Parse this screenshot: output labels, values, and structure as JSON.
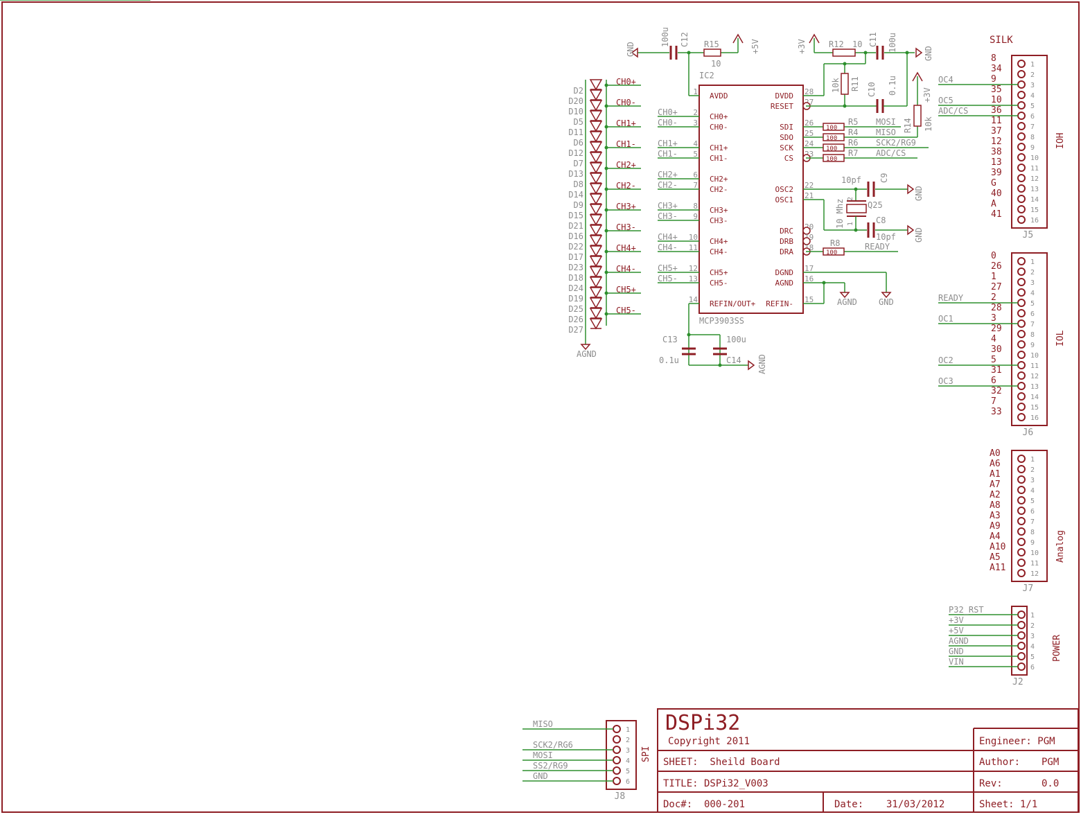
{
  "title_block": {
    "title": "DSPi32",
    "copyright": "Copyright 2011",
    "sheet": "SHEET:  Sheild Board",
    "name": "TITLE: DSPi32_V003",
    "doc": "Doc#:  000-201",
    "date_label": "Date:",
    "date": "31/03/2012",
    "engineer": "Engineer: PGM",
    "author_label": "Author:",
    "author": "PGM",
    "rev_label": "Rev:",
    "rev": "0.0",
    "sheet_no": "Sheet: 1/1"
  },
  "ic": {
    "ref": "IC2",
    "part": "MCP3903SS",
    "left_pins": [
      {
        "num": "1",
        "name": "AVDD",
        "net": ""
      },
      {
        "num": "2",
        "name": "CH0+",
        "net": "CH0+"
      },
      {
        "num": "3",
        "name": "CH0-",
        "net": "CH0-"
      },
      {
        "num": "4",
        "name": "CH1+",
        "net": "CH1+"
      },
      {
        "num": "5",
        "name": "CH1-",
        "net": "CH1-"
      },
      {
        "num": "6",
        "name": "CH2+",
        "net": "CH2+"
      },
      {
        "num": "7",
        "name": "CH2-",
        "net": "CH2-"
      },
      {
        "num": "8",
        "name": "CH3+",
        "net": "CH3+"
      },
      {
        "num": "9",
        "name": "CH3-",
        "net": "CH3-"
      },
      {
        "num": "10",
        "name": "CH4+",
        "net": "CH4+"
      },
      {
        "num": "11",
        "name": "CH4-",
        "net": "CH4-"
      },
      {
        "num": "12",
        "name": "CH5+",
        "net": "CH5+"
      },
      {
        "num": "13",
        "name": "CH5-",
        "net": "CH5-"
      },
      {
        "num": "14",
        "name": "REFIN/OUT+",
        "net": ""
      }
    ],
    "right_pins": [
      {
        "num": "28",
        "name": "DVDD"
      },
      {
        "num": "27",
        "name": "RESET"
      },
      {
        "num": "26",
        "name": "SDI"
      },
      {
        "num": "25",
        "name": "SDO"
      },
      {
        "num": "24",
        "name": "SCK"
      },
      {
        "num": "23",
        "name": "CS"
      },
      {
        "num": "22",
        "name": "OSC2"
      },
      {
        "num": "21",
        "name": "OSC1"
      },
      {
        "num": "20",
        "name": "DRC"
      },
      {
        "num": "19",
        "name": "DRB"
      },
      {
        "num": "18",
        "name": "DRA"
      },
      {
        "num": "17",
        "name": "DGND"
      },
      {
        "num": "16",
        "name": "AGND"
      },
      {
        "num": "15",
        "name": "REFIN-"
      }
    ]
  },
  "diodes": {
    "left_labels": [
      "D2",
      "D20",
      "D10",
      "D5",
      "D11",
      "D6",
      "D12",
      "D7",
      "D13",
      "D8",
      "D14",
      "D9",
      "D15",
      "D21",
      "D16",
      "D22",
      "D17",
      "D23",
      "D18",
      "D24",
      "D19",
      "D25",
      "D26",
      "D27"
    ],
    "nets": [
      "CH0+",
      "CH0-",
      "CH1+",
      "CH1-",
      "CH2+",
      "CH2-",
      "CH3+",
      "CH3-",
      "CH4+",
      "CH4-",
      "CH5+",
      "CH5-"
    ],
    "ground": "AGND"
  },
  "passives": {
    "c12": {
      "ref": "C12",
      "value": "100u"
    },
    "r15": {
      "ref": "R15",
      "value": "10"
    },
    "r12": {
      "ref": "R12",
      "value": "10"
    },
    "c11": {
      "ref": "C11",
      "value": "100u"
    },
    "r11": {
      "ref": "R11",
      "value": "10k"
    },
    "c10": {
      "ref": "C10",
      "value": "0.1u"
    },
    "r14": {
      "ref": "R14",
      "value": "10k"
    },
    "r5": "R5",
    "r4": "R4",
    "r6": "R6",
    "r7": "R7",
    "c9": {
      "ref": "C9",
      "value": "10pf"
    },
    "c8": {
      "ref": "C8",
      "value": "10pf"
    },
    "q25": {
      "ref": "Q25",
      "value": "10 Mhz",
      "pin1": "1",
      "pin2": "2"
    },
    "r8": {
      "ref": "R8"
    },
    "c13": {
      "ref": "C13",
      "value": "0.1u"
    },
    "c14": {
      "ref": "C14",
      "value": "100u"
    },
    "res_value": "100"
  },
  "power": {
    "gnd": "GND",
    "agnd": "AGND",
    "p5v": "+5V",
    "p3v": "+3V"
  },
  "nets": {
    "mosi": "MOSI",
    "miso": "MISO",
    "sck": "SCK2/RG9",
    "adc_cs": "ADC/CS",
    "ready": "READY"
  },
  "connectors": {
    "j5": {
      "ref": "J5",
      "name": "IOH",
      "silk_title": "SILK",
      "silk": [
        "8",
        "34",
        "9",
        "35",
        "10",
        "36",
        "11",
        "37",
        "12",
        "38",
        "13",
        "39",
        "G",
        "40",
        "A",
        "41"
      ],
      "wires": [
        {
          "pin": 3,
          "label": "OC4"
        },
        {
          "pin": 5,
          "label": "OC5"
        },
        {
          "pin": 6,
          "label": "ADC/CS"
        }
      ]
    },
    "j6": {
      "ref": "J6",
      "name": "IOL",
      "silk": [
        "0",
        "26",
        "1",
        "27",
        "2",
        "28",
        "3",
        "29",
        "4",
        "30",
        "5",
        "31",
        "6",
        "32",
        "7",
        "33"
      ],
      "wires": [
        {
          "pin": 5,
          "label": "READY"
        },
        {
          "pin": 7,
          "label": "OC1"
        },
        {
          "pin": 11,
          "label": "OC2"
        },
        {
          "pin": 13,
          "label": "OC3"
        }
      ]
    },
    "j7": {
      "ref": "J7",
      "name": "Analog",
      "silk": [
        "A0",
        "A6",
        "A1",
        "A7",
        "A2",
        "A8",
        "A3",
        "A9",
        "A4",
        "A10",
        "A5",
        "A11"
      ]
    },
    "j2": {
      "ref": "J2",
      "name": "POWER",
      "wires": [
        "P32_RST",
        "+3V",
        "+5V",
        "AGND",
        "GND",
        "VIN"
      ]
    },
    "j8": {
      "ref": "J8",
      "name": "SPI",
      "wires": [
        "MISO",
        "",
        "SCK2/RG6",
        "MOSI",
        "SS2/RG9",
        "GND"
      ]
    }
  },
  "colors": {
    "symbol": "#8e1e24",
    "wire": "#2d8f2d",
    "net_label": "#8c8c8c",
    "frame": "#8e1e24"
  }
}
